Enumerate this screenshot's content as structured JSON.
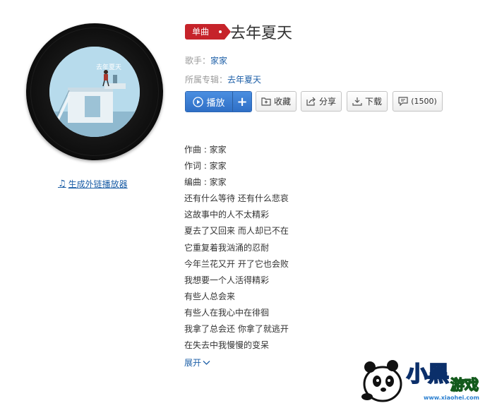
{
  "album": {
    "cover_text": "去年夏天"
  },
  "player_link": {
    "label": "生成外链播放器",
    "icon": "music-note-icon"
  },
  "song": {
    "badge": "单曲",
    "title": "去年夏天",
    "singer_label": "歌手：",
    "singer": "家家",
    "album_label": "所属专辑：",
    "album": "去年夏天"
  },
  "actions": {
    "play": "播放",
    "add": "+",
    "collect": "收藏",
    "share": "分享",
    "download": "下载",
    "comments": "(1500)"
  },
  "lyrics": [
    "作曲 : 家家",
    "作词 : 家家",
    "编曲 : 家家",
    "还有什么等待 还有什么悲哀",
    "这故事中的人不太精彩",
    "夏去了又回来 而人却已不在",
    "它重复着我汹涌的忍耐",
    "今年兰花又开 开了它也会败",
    "我想要一个人活得精彩",
    "有些人总会来",
    "有些人在我心中在徘徊",
    "我拿了总会还 你拿了就逃开",
    "在失去中我慢慢的变呆"
  ],
  "expand_label": "展开",
  "watermark": {
    "brand": "小黑游戏",
    "url": "www.xiaohei.com"
  },
  "colors": {
    "badge_red": "#c6232a",
    "link_blue": "#1d5fa7",
    "play_blue": "#2f6fc6"
  }
}
